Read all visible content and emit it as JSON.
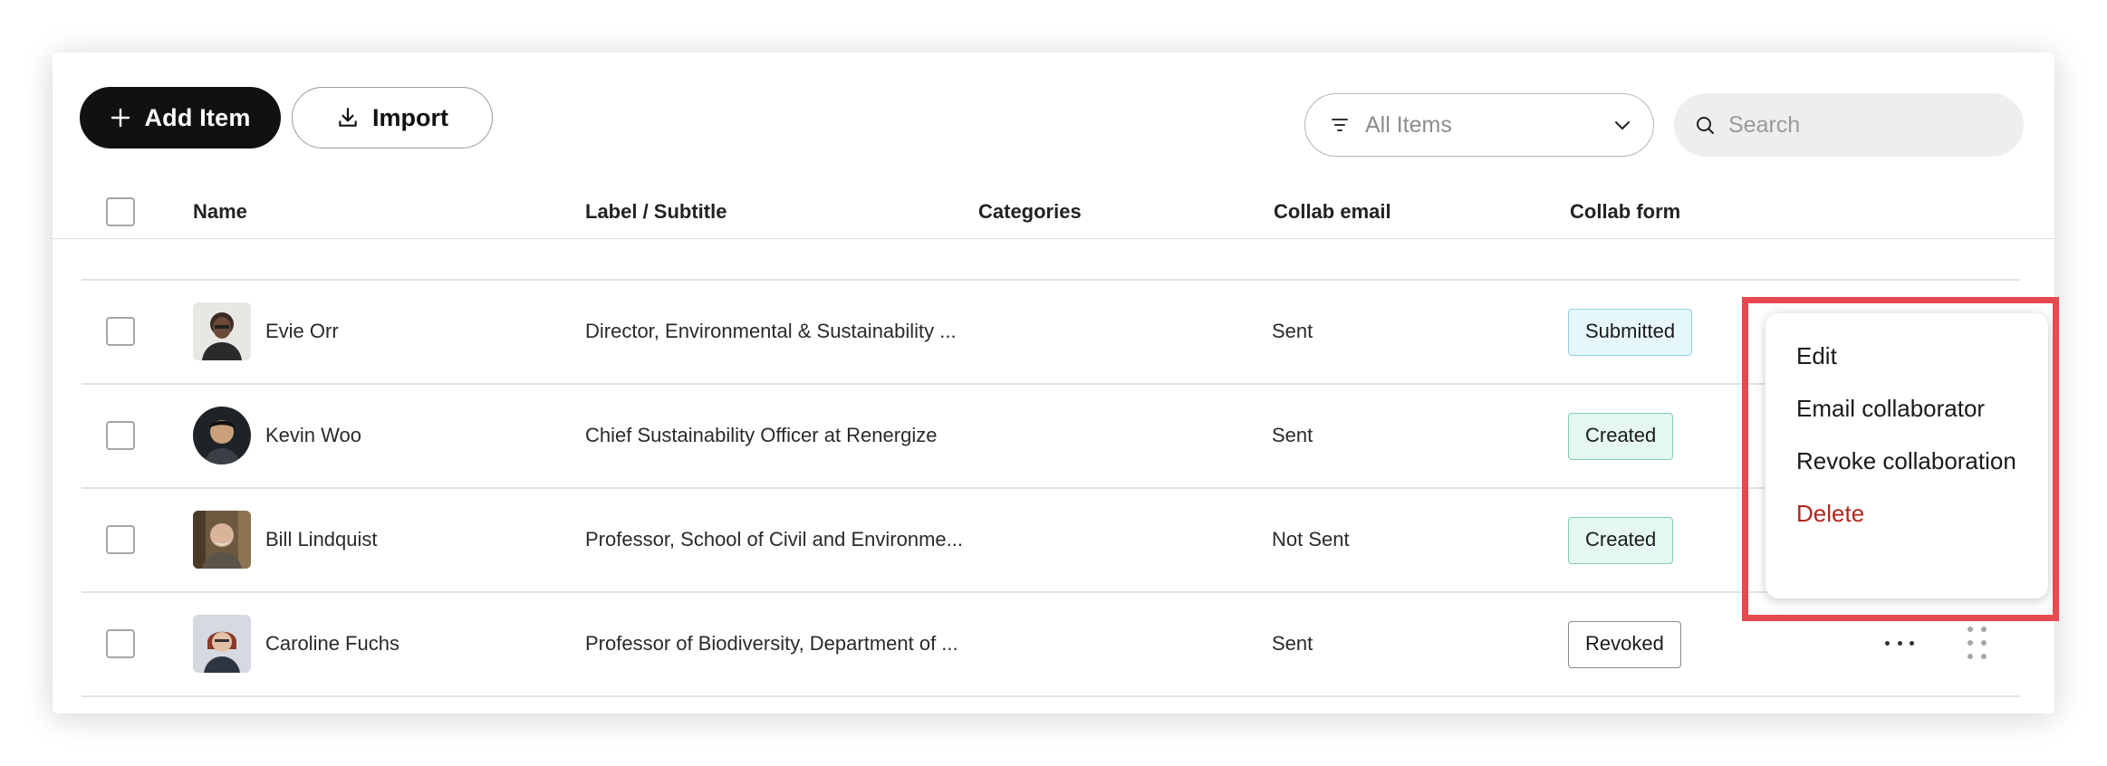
{
  "toolbar": {
    "add_label": "Add Item",
    "import_label": "Import",
    "filter_label": "All Items",
    "search_placeholder": "Search"
  },
  "table": {
    "columns": [
      "Name",
      "Label / Subtitle",
      "Categories",
      "Collab email",
      "Collab form"
    ],
    "rows": [
      {
        "name": "Evie Orr",
        "subtitle": "Director, Environmental & Sustainability ...",
        "categories": "",
        "collab_email": "Sent",
        "collab_form": "Submitted"
      },
      {
        "name": "Kevin Woo",
        "subtitle": "Chief Sustainability Officer at Renergize",
        "categories": "",
        "collab_email": "Sent",
        "collab_form": "Created"
      },
      {
        "name": "Bill Lindquist",
        "subtitle": "Professor, School of Civil and Environme...",
        "categories": "",
        "collab_email": "Not Sent",
        "collab_form": "Created"
      },
      {
        "name": "Caroline Fuchs",
        "subtitle": "Professor of Biodiversity, Department of ...",
        "categories": "",
        "collab_email": "Sent",
        "collab_form": "Revoked"
      }
    ]
  },
  "context_menu": {
    "items": [
      "Edit",
      "Email collaborator",
      "Revoke collaboration",
      "Delete"
    ]
  },
  "icons": {
    "add": "plus-icon",
    "import": "download-icon",
    "filter": "filter-lines-icon",
    "filter_toggle": "chevron-down-icon",
    "search": "search-icon",
    "row_menu": "more-horizontal-icon",
    "row_drag": "drag-handle-icon"
  },
  "colors": {
    "primary_button": "#111111",
    "submitted_badge_bg": "#e6f7fc",
    "created_badge_bg": "#e4f7f1",
    "delete_text": "#b3261e",
    "highlight_box": "#e8484f"
  }
}
